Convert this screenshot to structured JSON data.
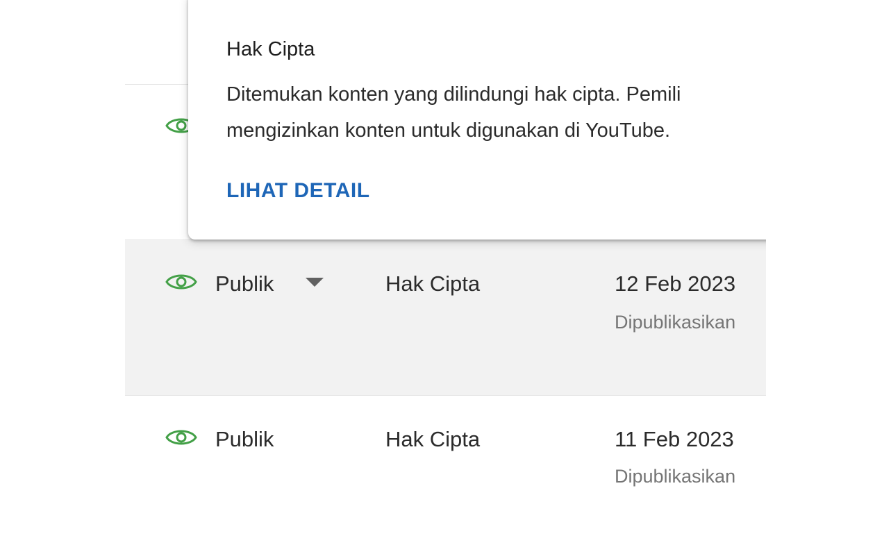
{
  "popup": {
    "title": "Hak Cipta",
    "body_line1": "Ditemukan konten yang dilindungi hak cipta. Pemili",
    "body_line2": "mengizinkan konten untuk digunakan di YouTube.",
    "link_label": "LIHAT DETAIL"
  },
  "rows": [
    {
      "visibility": "Publik",
      "restriction": "Hak Cipta",
      "date": "12 Feb 2023",
      "status": "Dipublikasikan",
      "icon": "eye-icon",
      "dropdown_icon": "caret-down-icon"
    },
    {
      "visibility": "Publik",
      "restriction": "Hak Cipta",
      "date": "11 Feb 2023",
      "status": "Dipublikasikan",
      "icon": "eye-icon"
    }
  ],
  "colors": {
    "eye_icon": "#43a047",
    "link": "#1e66b7",
    "hover_row": "#f2f2f2",
    "secondary_text": "#757575"
  }
}
